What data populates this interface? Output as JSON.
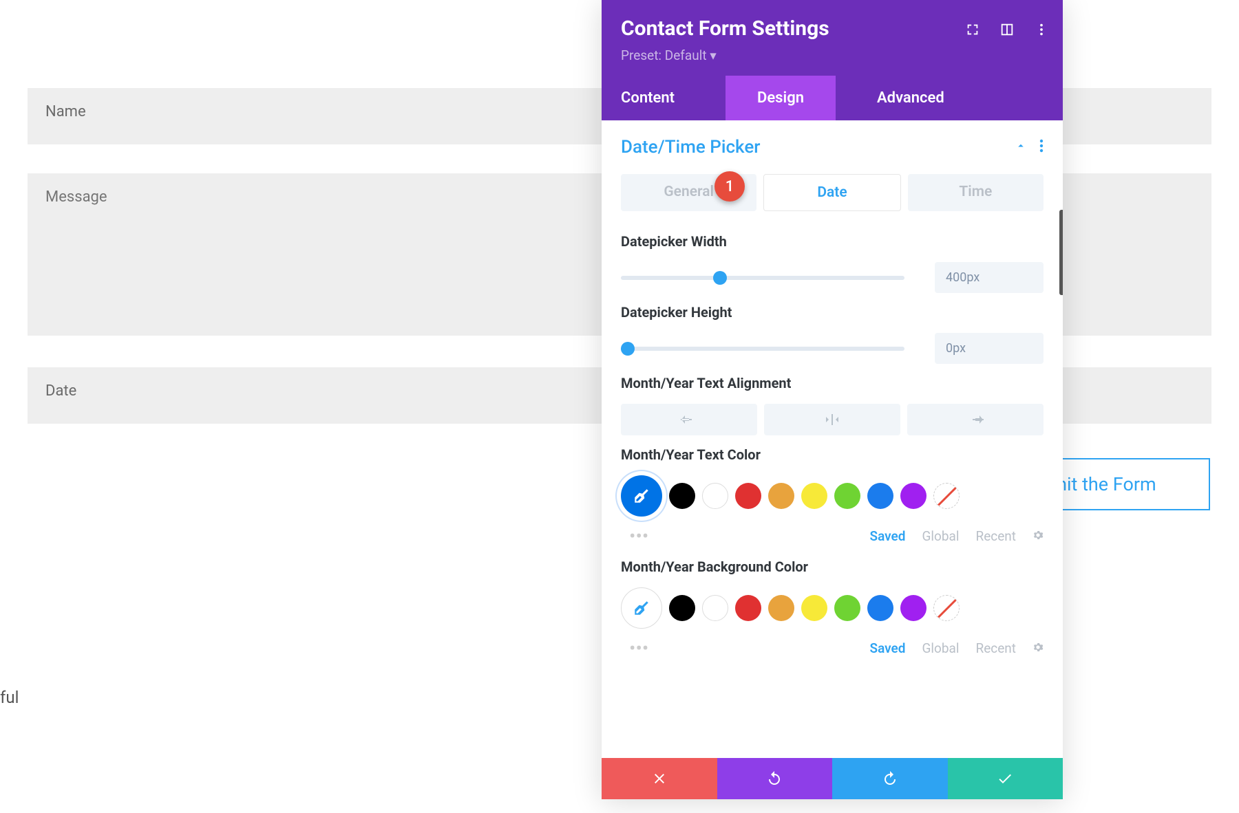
{
  "form": {
    "name_placeholder": "Name",
    "message_placeholder": "Message",
    "date_placeholder": "Date",
    "submit_partial": "mit the Form"
  },
  "stray_text": "ful",
  "panel": {
    "title": "Contact Form Settings",
    "preset_label": "Preset: Default",
    "tabs": {
      "content": "Content",
      "design": "Design",
      "advanced": "Advanced"
    },
    "section_title": "Date/Time Picker",
    "sub_tabs": {
      "general": "General",
      "date": "Date",
      "time": "Time"
    },
    "badge": "1",
    "options": {
      "width_label": "Datepicker Width",
      "width_value": "400px",
      "height_label": "Datepicker Height",
      "height_value": "0px",
      "align_label": "Month/Year Text Alignment",
      "text_color_label": "Month/Year Text Color",
      "bg_color_label": "Month/Year Background Color"
    },
    "swatch_cats": {
      "saved": "Saved",
      "global": "Global",
      "recent": "Recent"
    },
    "swatch_colors": [
      "#000000",
      "#ffffff",
      "#e03131",
      "#e8a33d",
      "#f7e938",
      "#6fd333",
      "#1b7ced",
      "#a020f0"
    ]
  }
}
